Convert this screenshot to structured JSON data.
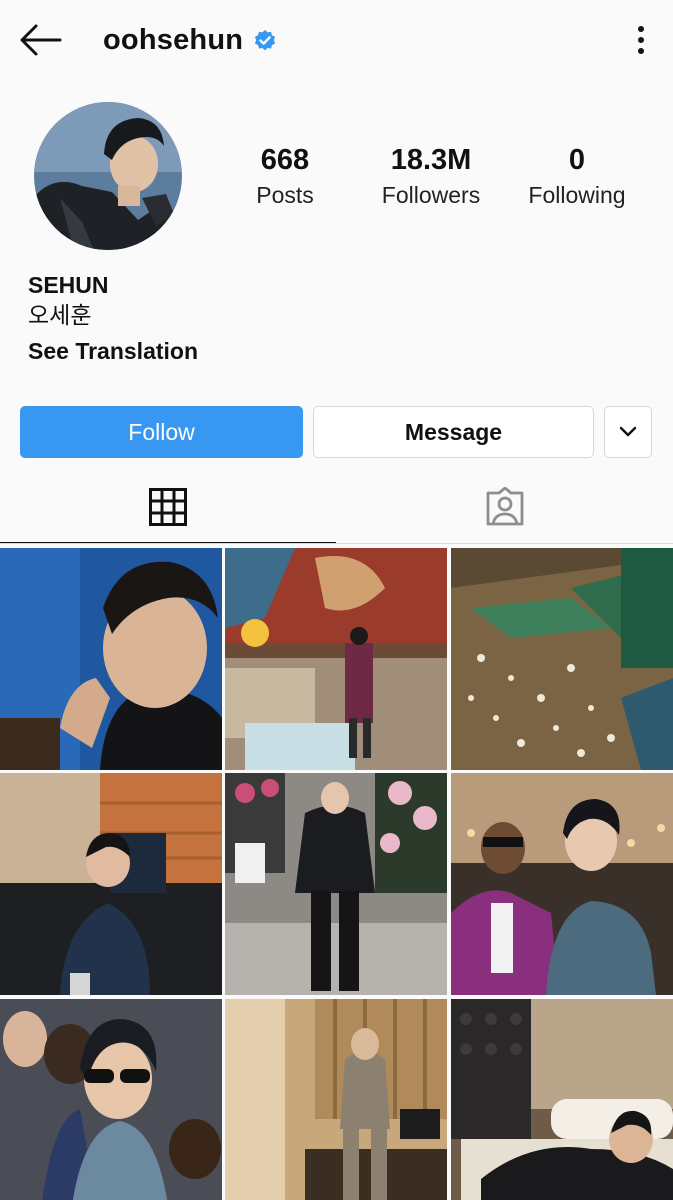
{
  "header": {
    "username": "oohsehun",
    "back_icon": "arrow-left-icon",
    "verified_icon": "verified-badge-icon",
    "more_icon": "vertical-dots-icon",
    "verified_color": "#3897f0"
  },
  "profile": {
    "stats": [
      {
        "value": "668",
        "label": "Posts"
      },
      {
        "value": "18.3M",
        "label": "Followers"
      },
      {
        "value": "0",
        "label": "Following"
      }
    ],
    "name": "SEHUN",
    "native_name": "오세훈",
    "see_translation": "See Translation"
  },
  "actions": {
    "follow_label": "Follow",
    "message_label": "Message",
    "dropdown_icon": "chevron-down-icon",
    "accent": "#3897f0"
  },
  "tabs": [
    {
      "name": "grid",
      "icon": "grid-icon",
      "active": true
    },
    {
      "name": "tagged",
      "icon": "tagged-person-icon",
      "active": false
    }
  ]
}
